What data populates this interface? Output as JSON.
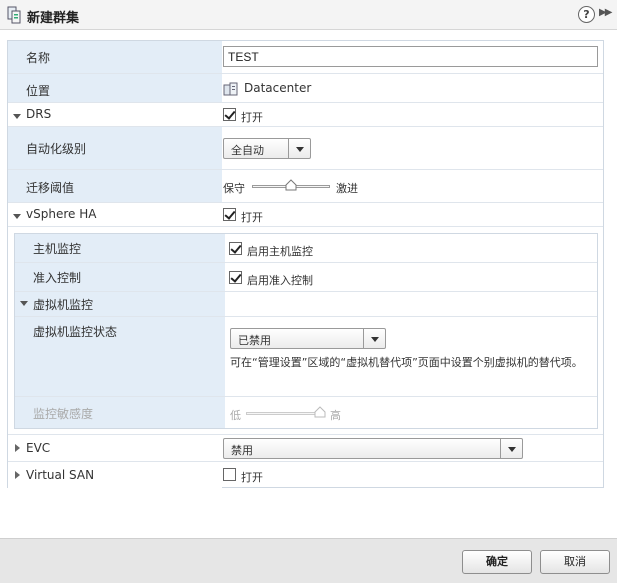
{
  "dialog": {
    "title": "新建群集",
    "help": "?",
    "expand": "▶▶"
  },
  "form": {
    "name": {
      "label": "名称",
      "value": "TEST"
    },
    "location": {
      "label": "位置",
      "value": "Datacenter"
    },
    "drs": {
      "label": "DRS",
      "checked": true,
      "checkbox_label": "打开",
      "automation": {
        "label": "自动化级别",
        "value": "全自动"
      },
      "migration": {
        "label": "迁移阈值",
        "left_label": "保守",
        "right_label": "激进"
      }
    },
    "ha": {
      "label": "vSphere HA",
      "checked": true,
      "checkbox_label": "打开",
      "host_monitoring": {
        "label": "主机监控",
        "checkbox_label": "启用主机监控",
        "checked": true
      },
      "admission_control": {
        "label": "准入控制",
        "checkbox_label": "启用准入控制",
        "checked": true
      },
      "vm_monitoring": {
        "label": "虚拟机监控",
        "status": {
          "label": "虚拟机监控状态",
          "value": "已禁用",
          "note": "可在“管理设置”区域的“虚拟机替代项”页面中设置个别虚拟机的替代项。"
        },
        "sensitivity": {
          "label": "监控敏感度",
          "left_label": "低",
          "right_label": "高"
        }
      }
    },
    "evc": {
      "label": "EVC",
      "value": "禁用"
    },
    "vsan": {
      "label": "Virtual SAN",
      "checked": false,
      "checkbox_label": "打开"
    }
  },
  "footer": {
    "ok": "确定",
    "cancel": "取消"
  }
}
